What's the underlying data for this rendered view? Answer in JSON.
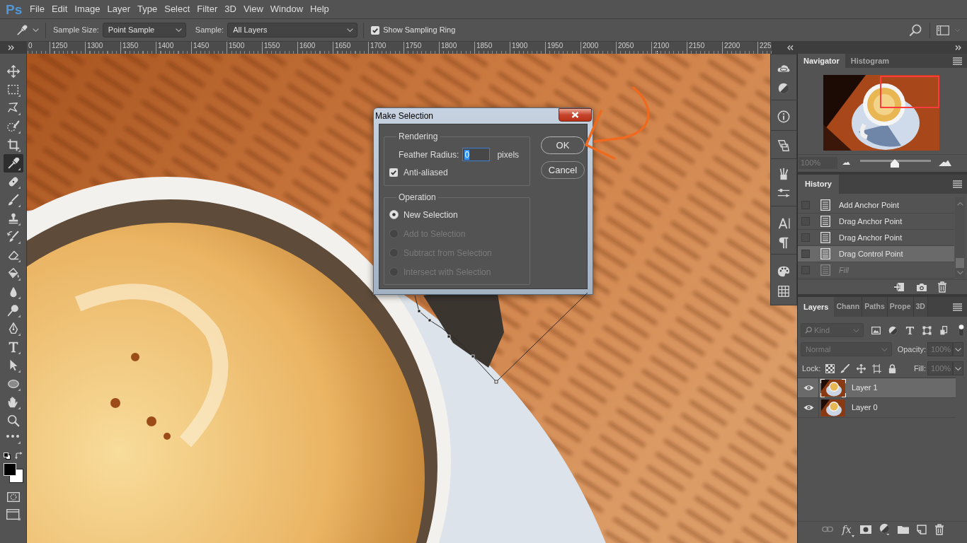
{
  "menu_bar": {
    "logo": "Ps",
    "items": [
      "File",
      "Edit",
      "Image",
      "Layer",
      "Type",
      "Select",
      "Filter",
      "3D",
      "View",
      "Window",
      "Help"
    ]
  },
  "options_bar": {
    "sample_size": {
      "label": "Sample Size:",
      "value": "Point Sample"
    },
    "sample": {
      "label": "Sample:",
      "value": "All Layers"
    },
    "show_sampling_ring": {
      "label": "Show Sampling Ring",
      "checked": true
    }
  },
  "ruler": {
    "labels": [
      "0",
      "1250",
      "1300",
      "1350",
      "1400",
      "1450",
      "1500",
      "1550",
      "1600",
      "1650",
      "1700",
      "1750",
      "1800",
      "1850",
      "1900",
      "1950",
      "2000",
      "2050",
      "2100",
      "2150",
      "2200",
      "225"
    ]
  },
  "tools": [
    {
      "selected": false
    },
    {
      "selected": false
    },
    {
      "selected": false
    },
    {
      "selected": false
    },
    {
      "selected": false
    },
    {
      "selected": true
    },
    {
      "selected": false
    },
    {
      "selected": false
    },
    {
      "selected": false
    },
    {
      "selected": false
    },
    {
      "selected": false
    },
    {
      "selected": false
    },
    {
      "selected": false
    },
    {
      "selected": false
    },
    {
      "selected": false
    },
    {
      "selected": false
    },
    {
      "selected": false
    },
    {
      "selected": false
    },
    {
      "selected": false
    },
    {
      "selected": false
    },
    {
      "selected": false
    }
  ],
  "dialog": {
    "title": "Make Selection",
    "rendering": {
      "legend": "Rendering",
      "feather_radius": {
        "label": "Feather Radius:",
        "value": "0",
        "unit": "pixels"
      },
      "anti_aliased": {
        "label": "Anti-aliased",
        "checked": true
      }
    },
    "operation": {
      "legend": "Operation",
      "options": [
        {
          "label": "New Selection",
          "selected": true,
          "disabled": false
        },
        {
          "label": "Add to Selection",
          "selected": false,
          "disabled": true
        },
        {
          "label": "Subtract from Selection",
          "selected": false,
          "disabled": true
        },
        {
          "label": "Intersect with Selection",
          "selected": false,
          "disabled": true
        }
      ]
    },
    "buttons": [
      "OK",
      "Cancel"
    ]
  },
  "navigator": {
    "tabs": [
      {
        "label": "Navigator",
        "selected": true
      },
      {
        "label": "Histogram",
        "selected": false
      }
    ],
    "zoom": "100%",
    "zoom_slider": {
      "level": 0.49
    }
  },
  "history": {
    "tabs": [
      {
        "label": "History",
        "selected": true
      }
    ],
    "items": [
      {
        "label": "Add Anchor Point",
        "selected": false,
        "undone": false
      },
      {
        "label": "Drag Anchor Point",
        "selected": false,
        "undone": false
      },
      {
        "label": "Drag Anchor Point",
        "selected": false,
        "undone": false
      },
      {
        "label": "Drag Control Point",
        "selected": true,
        "undone": false
      },
      {
        "label": "Fill",
        "selected": false,
        "undone": true
      }
    ]
  },
  "layers": {
    "tabs": [
      {
        "label": "Layers",
        "selected": true
      },
      {
        "label": "Chann",
        "selected": false
      },
      {
        "label": "Paths",
        "selected": false
      },
      {
        "label": "Prope",
        "selected": false
      },
      {
        "label": "3D",
        "selected": false
      }
    ],
    "filter": {
      "value": "Kind",
      "on": true
    },
    "blend_mode": {
      "value": "Normal",
      "disabled": true
    },
    "opacity": {
      "label": "Opacity:",
      "value": "100%",
      "disabled": true
    },
    "lock": {
      "label": "Lock:"
    },
    "fill": {
      "label": "Fill:",
      "value": "100%",
      "disabled": true
    },
    "items": [
      {
        "name": "Layer 1",
        "selected": true,
        "visible": true
      },
      {
        "name": "Layer 0",
        "selected": false,
        "visible": true
      }
    ],
    "effects_button": "fx"
  }
}
